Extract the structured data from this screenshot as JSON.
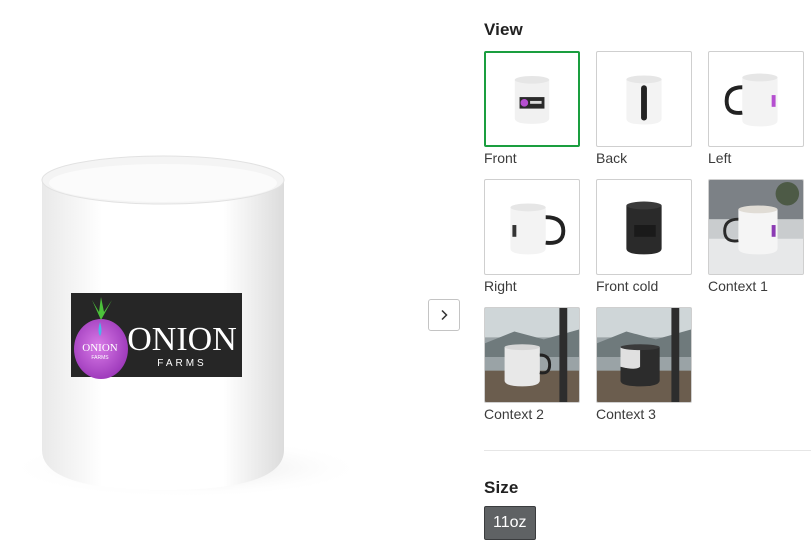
{
  "preview": {
    "logo_word": "ONION",
    "logo_sub": "FARMS",
    "logo_inner": "ONION",
    "logo_inner_sub": "FARMS"
  },
  "view": {
    "title": "View",
    "thumbnails": [
      {
        "label": "Front",
        "selected": true
      },
      {
        "label": "Back",
        "selected": false
      },
      {
        "label": "Left",
        "selected": false
      },
      {
        "label": "Right",
        "selected": false
      },
      {
        "label": "Front cold",
        "selected": false
      },
      {
        "label": "Context 1",
        "selected": false
      },
      {
        "label": "Context 2",
        "selected": false
      },
      {
        "label": "Context 3",
        "selected": false
      }
    ]
  },
  "size": {
    "title": "Size",
    "selected": "11oz"
  },
  "colors": {
    "selected_border": "#1a9e3f",
    "chip_bg": "#5f6264",
    "logo_purple": "#b54fd0",
    "logo_green": "#4cc23a"
  },
  "icons": {
    "next": "chevron-right-icon"
  }
}
